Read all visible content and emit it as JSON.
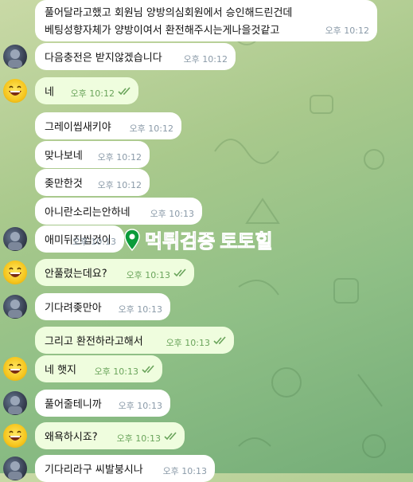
{
  "messages": [
    {
      "side": "other",
      "lines": [
        "풀어달라고했고 회원님 양방의심회원에서 승인해드린건데",
        "베팅성향자체가 양방이여서 환전해주시는게나을것같고"
      ],
      "time": "오후 10:12"
    },
    {
      "side": "other",
      "lines": [
        "다음충전은 받지않겠습니다"
      ],
      "time": "오후 10:12"
    },
    {
      "side": "me",
      "lines": [
        "네"
      ],
      "time": "오후 10:12"
    },
    {
      "side": "other",
      "lines": [
        "그레이씹새키야"
      ],
      "time": "오후 10:12"
    },
    {
      "side": "other",
      "lines": [
        "맞나보네"
      ],
      "time": "오후 10:12"
    },
    {
      "side": "other",
      "lines": [
        "좆만한것"
      ],
      "time": "오후 10:12"
    },
    {
      "side": "other",
      "lines": [
        "아니란소리는안하네"
      ],
      "time": "오후 10:13"
    },
    {
      "side": "other",
      "lines": [
        "애미뒤진씹것이"
      ],
      "time": "오후 10:13"
    },
    {
      "side": "me",
      "lines": [
        "안풀렸는데요?"
      ],
      "time": "오후 10:13"
    },
    {
      "side": "other",
      "lines": [
        "기다려좆만아"
      ],
      "time": "오후 10:13"
    },
    {
      "side": "me",
      "lines": [
        "그리고 환전하라고해서"
      ],
      "time": "오후 10:13"
    },
    {
      "side": "me",
      "lines": [
        "네 햇지"
      ],
      "time": "오후 10:13"
    },
    {
      "side": "other",
      "lines": [
        "풀어줄테니까"
      ],
      "time": "오후 10:13"
    },
    {
      "side": "me",
      "lines": [
        "왜욕하시죠?"
      ],
      "time": "오후 10:13"
    },
    {
      "side": "other",
      "lines": [
        "기다리라구 씨발붕시나"
      ],
      "time": "오후 10:13"
    }
  ],
  "watermark": {
    "part1": "먹튀검증",
    "part2": "토토힐",
    "icon": "map-pin-icon"
  },
  "colors": {
    "incoming": "#ffffff",
    "outgoing": "#effdde",
    "time": "#8a9aa8",
    "check": "#6aa45b",
    "watermark_green": "#0b9b3a"
  }
}
